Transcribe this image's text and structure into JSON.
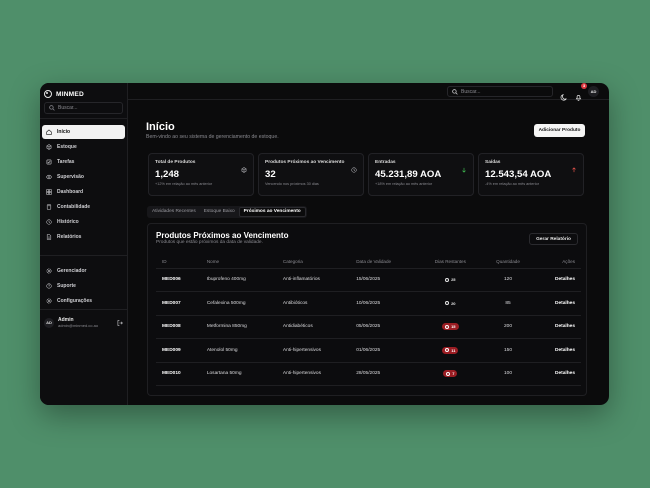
{
  "app": {
    "brand": "MINMED"
  },
  "sidebar": {
    "search_placeholder": "Buscar...",
    "items": [
      {
        "label": "Início",
        "icon": "home-icon",
        "active": true
      },
      {
        "label": "Estoque",
        "icon": "box-icon"
      },
      {
        "label": "Tarefas",
        "icon": "tasks-icon"
      },
      {
        "label": "Supervisão",
        "icon": "eye-icon"
      },
      {
        "label": "Dashboard",
        "icon": "dashboard-icon"
      },
      {
        "label": "Contabilidade",
        "icon": "calculator-icon"
      },
      {
        "label": "Histórico",
        "icon": "history-icon"
      },
      {
        "label": "Relatórios",
        "icon": "report-icon"
      }
    ],
    "bottom_items": [
      {
        "label": "Gerenciador",
        "icon": "settings-gear-icon"
      },
      {
        "label": "Suporte",
        "icon": "help-icon"
      },
      {
        "label": "Configurações",
        "icon": "gear-icon"
      }
    ],
    "user": {
      "initials": "AD",
      "name": "Admin",
      "email": "admin@minmed.co.ao"
    }
  },
  "topbar": {
    "search_placeholder": "Buscar...",
    "notification_count": "3",
    "avatar_initials": "AD"
  },
  "page": {
    "title": "Início",
    "subtitle": "Bem-vindo ao seu sistema de gerenciamento de estoque.",
    "primary_button": "Adicionar Produto"
  },
  "cards": [
    {
      "title": "Total de Produtos",
      "value": "1,248",
      "sub": "+12% em relação ao mês anterior",
      "icon": "package-icon"
    },
    {
      "title": "Produtos Próximos ao Vencimento",
      "value": "32",
      "sub": "Vencendo nos próximos 30 dias",
      "icon": "clock-icon"
    },
    {
      "title": "Entradas",
      "value": "45.231,89 AOA",
      "sub": "+18% em relação ao mês anterior",
      "icon": "arrow-down-icon",
      "icon_color": "#3fb950"
    },
    {
      "title": "Saídas",
      "value": "12.543,54 AOA",
      "sub": "-4% em relação ao mês anterior",
      "icon": "arrow-up-icon",
      "icon_color": "#e5534b"
    }
  ],
  "tabs": [
    {
      "label": "Atividades Recentes"
    },
    {
      "label": "Estoque Baixo"
    },
    {
      "label": "Próximos ao Vencimento",
      "active": true
    }
  ],
  "panel": {
    "title": "Produtos Próximos ao Vencimento",
    "subtitle": "Produtos que estão próximos da data de validade.",
    "report_button": "Gerar Relatório",
    "columns": [
      "ID",
      "Nome",
      "Categoria",
      "Data de Validade",
      "Dias Restantes",
      "Quantidade",
      "Ações"
    ],
    "rows": [
      {
        "id": "MED006",
        "name": "Ibuprofeno 400mg",
        "category": "Anti-inflamatórios",
        "date": "15/06/2025",
        "days": "25",
        "warn": false,
        "qty": "120",
        "action": "Detalhes"
      },
      {
        "id": "MED007",
        "name": "Cefalexina 500mg",
        "category": "Antibióticos",
        "date": "10/06/2025",
        "days": "20",
        "warn": false,
        "qty": "85",
        "action": "Detalhes"
      },
      {
        "id": "MED008",
        "name": "Metformina 850mg",
        "category": "Antidiabéticos",
        "date": "05/06/2025",
        "days": "15",
        "warn": true,
        "qty": "200",
        "action": "Detalhes"
      },
      {
        "id": "MED009",
        "name": "Atenolol 50mg",
        "category": "Anti-hipertensivos",
        "date": "01/06/2025",
        "days": "11",
        "warn": true,
        "qty": "150",
        "action": "Detalhes"
      },
      {
        "id": "MED010",
        "name": "Losartana 50mg",
        "category": "Anti-hipertensivos",
        "date": "28/05/2025",
        "days": "7",
        "warn": true,
        "qty": "100",
        "action": "Detalhes"
      }
    ]
  },
  "colors": {
    "background": "#4f8f6a",
    "window": "#0b0b0c",
    "warn_badge": "#9b1d23"
  }
}
